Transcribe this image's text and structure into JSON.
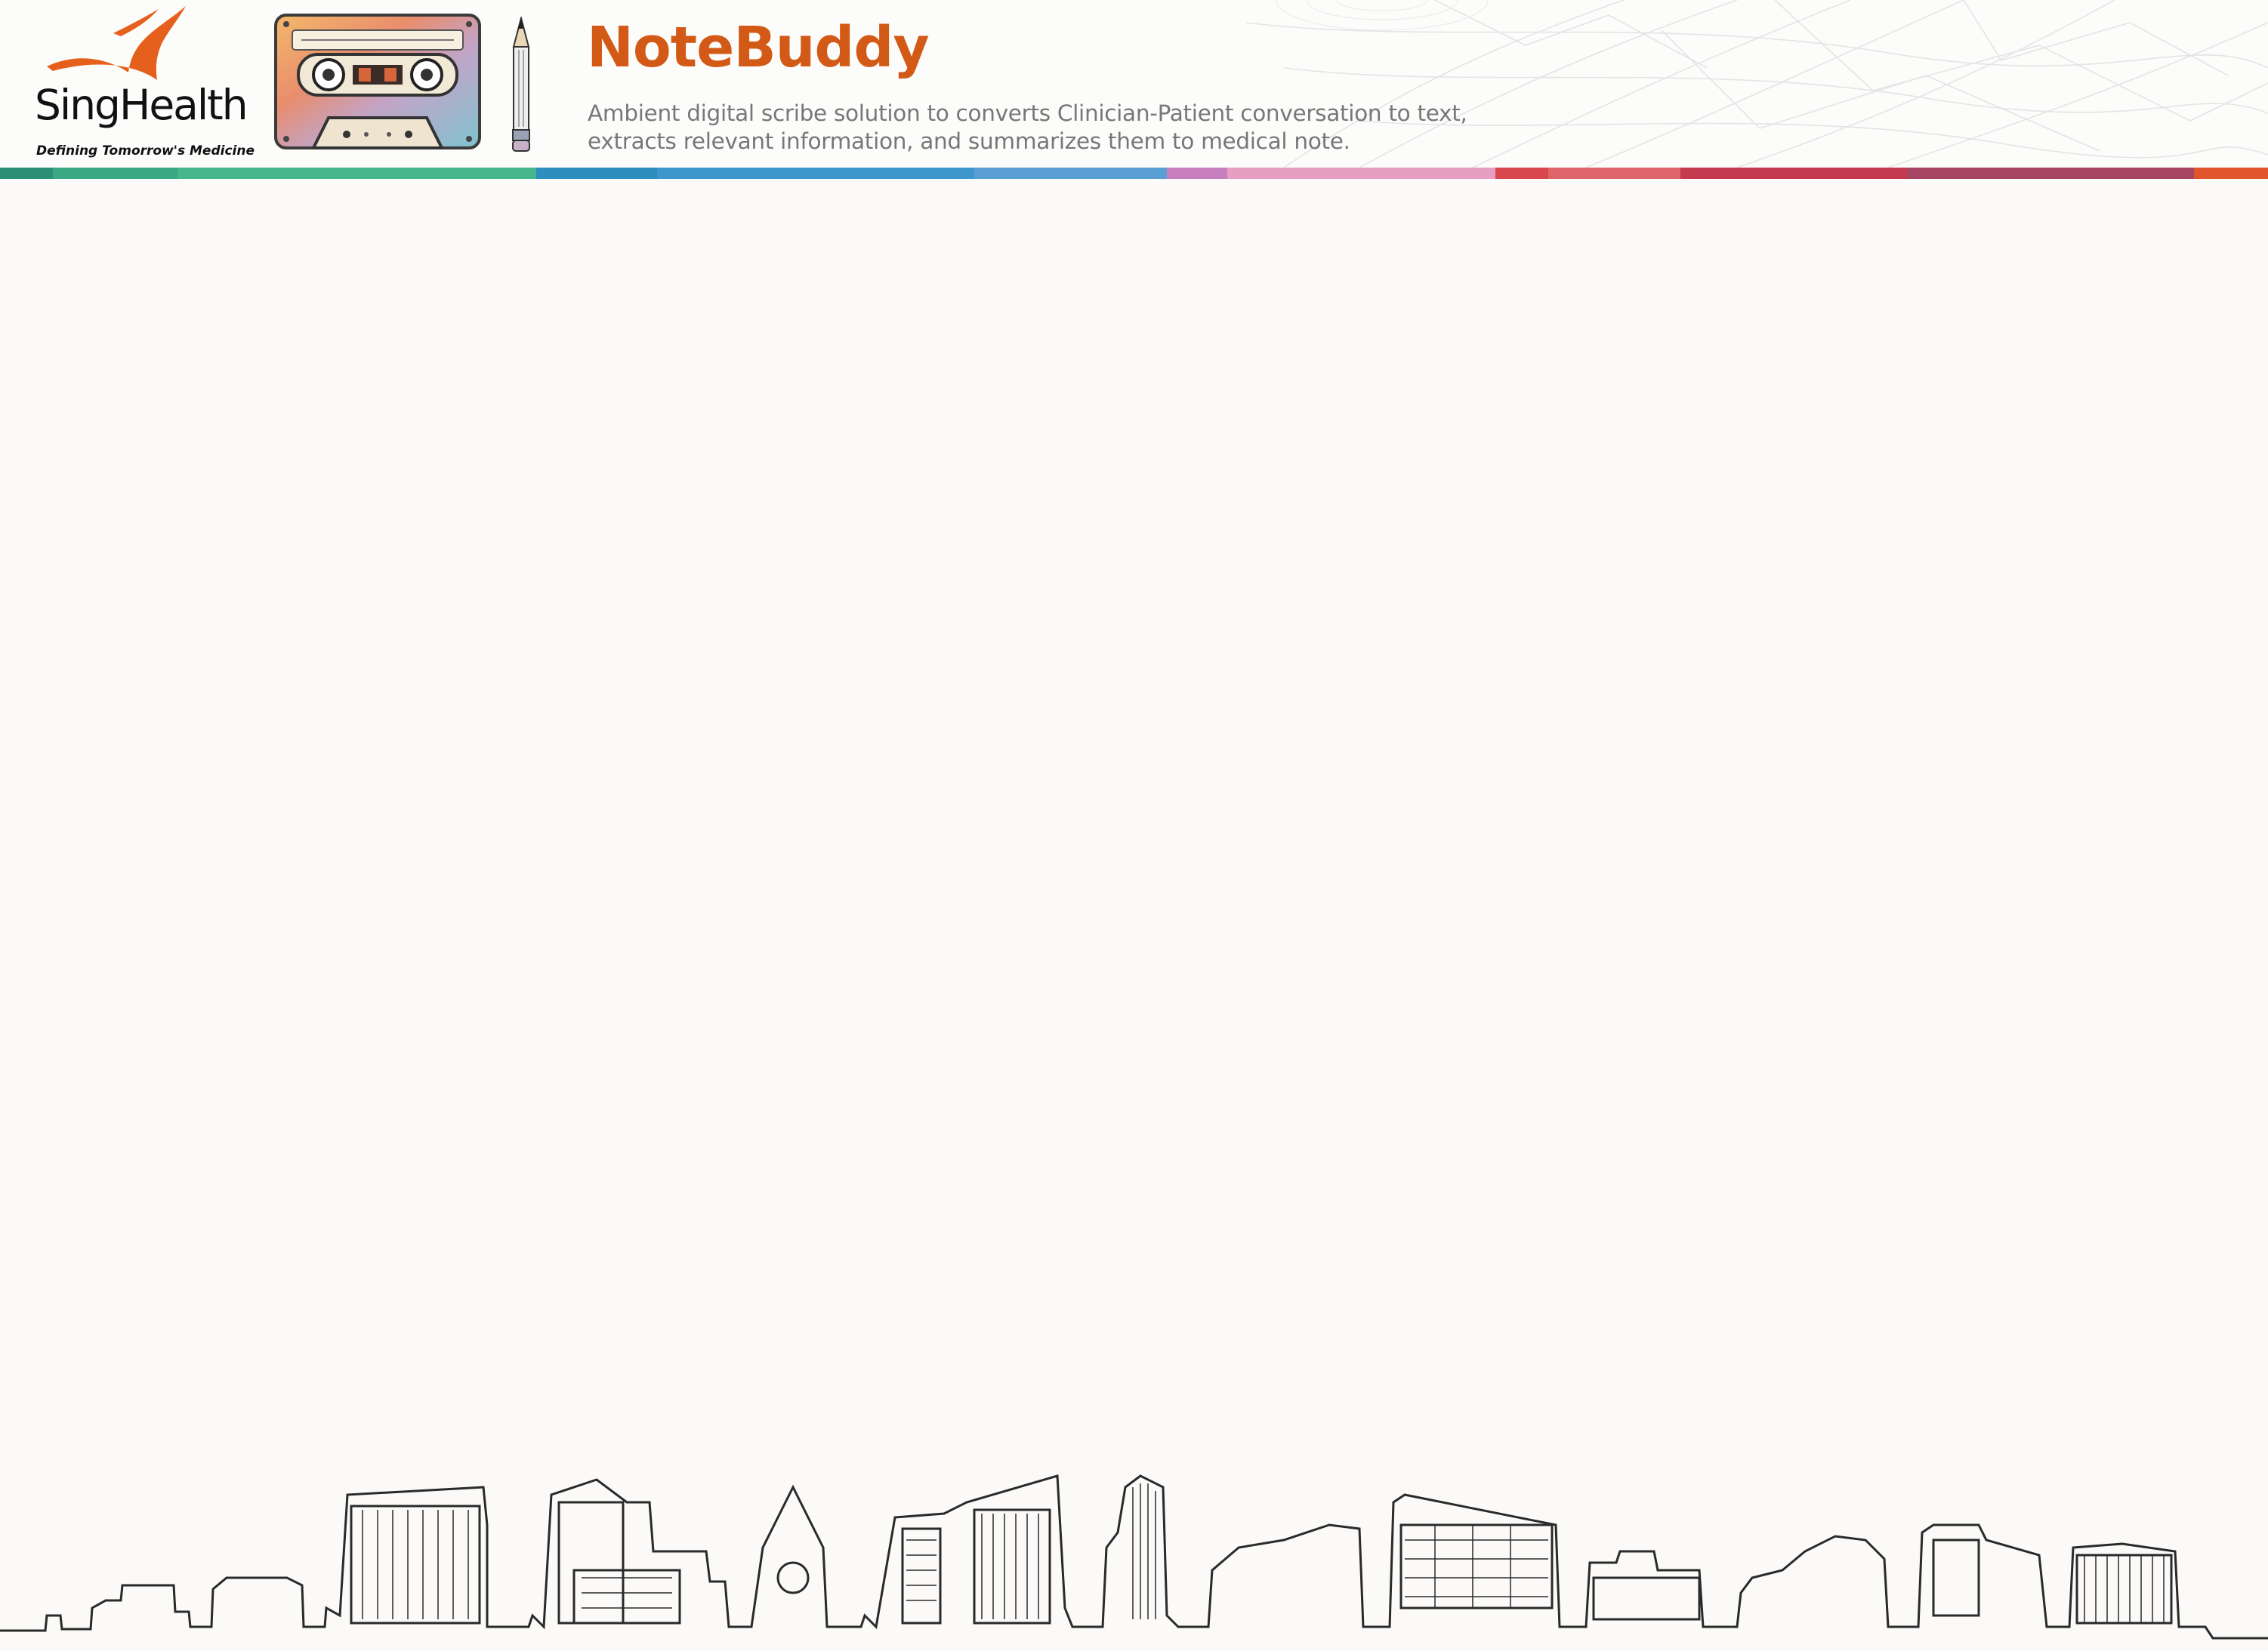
{
  "brand": {
    "name": "SingHealth",
    "tagline": "Defining Tomorrow's Medicine",
    "accent_color": "#e5601c"
  },
  "app": {
    "title": "NoteBuddy",
    "description": "Ambient digital scribe solution to converts Clinician-Patient conversation to text, extracts relevant information, and summarizes them to medical note.",
    "title_color": "#d35a16"
  },
  "header_art": {
    "cassette_icon": "cassette-tape-icon",
    "pencil_icon": "pencil-icon"
  },
  "color_bar": {
    "colors": [
      "#2a8f74",
      "#3aa882",
      "#46b78c",
      "#2c8fc0",
      "#3d97cd",
      "#5a9fd4",
      "#c77fbf",
      "#e89dc2",
      "#d9474e",
      "#e0656a",
      "#c43a4e",
      "#a84564",
      "#e1552c"
    ]
  },
  "footer_art": {
    "skyline": "city-skyline-illustration"
  }
}
